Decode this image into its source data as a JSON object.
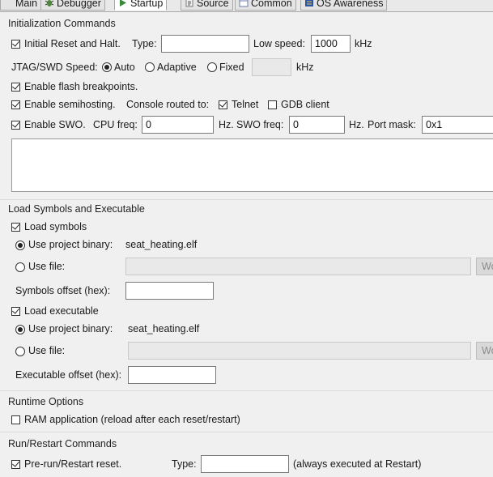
{
  "tabs": [
    {
      "label": "Main",
      "icon": "main-tab-icon"
    },
    {
      "label": "Debugger",
      "icon": "bug-icon"
    },
    {
      "label": "Startup",
      "icon": "startup-icon",
      "active": true
    },
    {
      "label": "Source",
      "icon": "source-icon"
    },
    {
      "label": "Common",
      "icon": "common-icon"
    },
    {
      "label": "OS Awareness",
      "icon": "os-icon"
    }
  ],
  "init": {
    "title": "Initialization Commands",
    "initial_reset_label": "Initial Reset and Halt.",
    "initial_reset_checked": true,
    "type_label": "Type:",
    "type_value": "",
    "low_speed_label": "Low speed:",
    "low_speed_value": "1000",
    "khz": "kHz",
    "jtag_label": "JTAG/SWD Speed:",
    "speed_auto": "Auto",
    "speed_adaptive": "Adaptive",
    "speed_fixed": "Fixed",
    "speed_selected": "Auto",
    "fixed_value": "",
    "fixed_khz": "kHz",
    "flash_bp_label": "Enable flash breakpoints.",
    "flash_bp_checked": true,
    "semihosting_label": "Enable semihosting.",
    "semihosting_checked": true,
    "console_label": "Console routed to:",
    "telnet_label": "Telnet",
    "telnet_checked": true,
    "gdb_client_label": "GDB client",
    "gdb_client_checked": false,
    "swo_label": "Enable SWO.",
    "swo_checked": true,
    "cpu_freq_label": "CPU freq:",
    "cpu_freq_value": "0",
    "hz1": "Hz.",
    "swo_freq_label": "SWO freq:",
    "swo_freq_value": "0",
    "hz2": "Hz.",
    "port_mask_label": "Port mask:",
    "port_mask_value": "0x1",
    "commands_text": ""
  },
  "load": {
    "title": "Load Symbols and Executable",
    "load_symbols_label": "Load symbols",
    "load_symbols_checked": true,
    "sym_use_project_label": "Use project binary:",
    "sym_project_binary": "seat_heating.elf",
    "sym_use_file_label": "Use file:",
    "sym_file_value": "",
    "sym_browse_label": "Wo",
    "sym_offset_label": "Symbols offset (hex):",
    "sym_offset_value": "",
    "load_exec_label": "Load executable",
    "load_exec_checked": true,
    "exe_use_project_label": "Use project binary:",
    "exe_project_binary": "seat_heating.elf",
    "exe_use_file_label": "Use file:",
    "exe_file_value": "",
    "exe_browse_label": "Wo",
    "exe_offset_label": "Executable offset (hex):",
    "exe_offset_value": ""
  },
  "runtime": {
    "title": "Runtime Options",
    "ram_app_label": "RAM application (reload after each reset/restart)",
    "ram_app_checked": false
  },
  "run": {
    "title": "Run/Restart Commands",
    "prerun_label": "Pre-run/Restart reset.",
    "prerun_checked": true,
    "type_label": "Type:",
    "type_value": "",
    "always_label": "(always executed at Restart)"
  }
}
